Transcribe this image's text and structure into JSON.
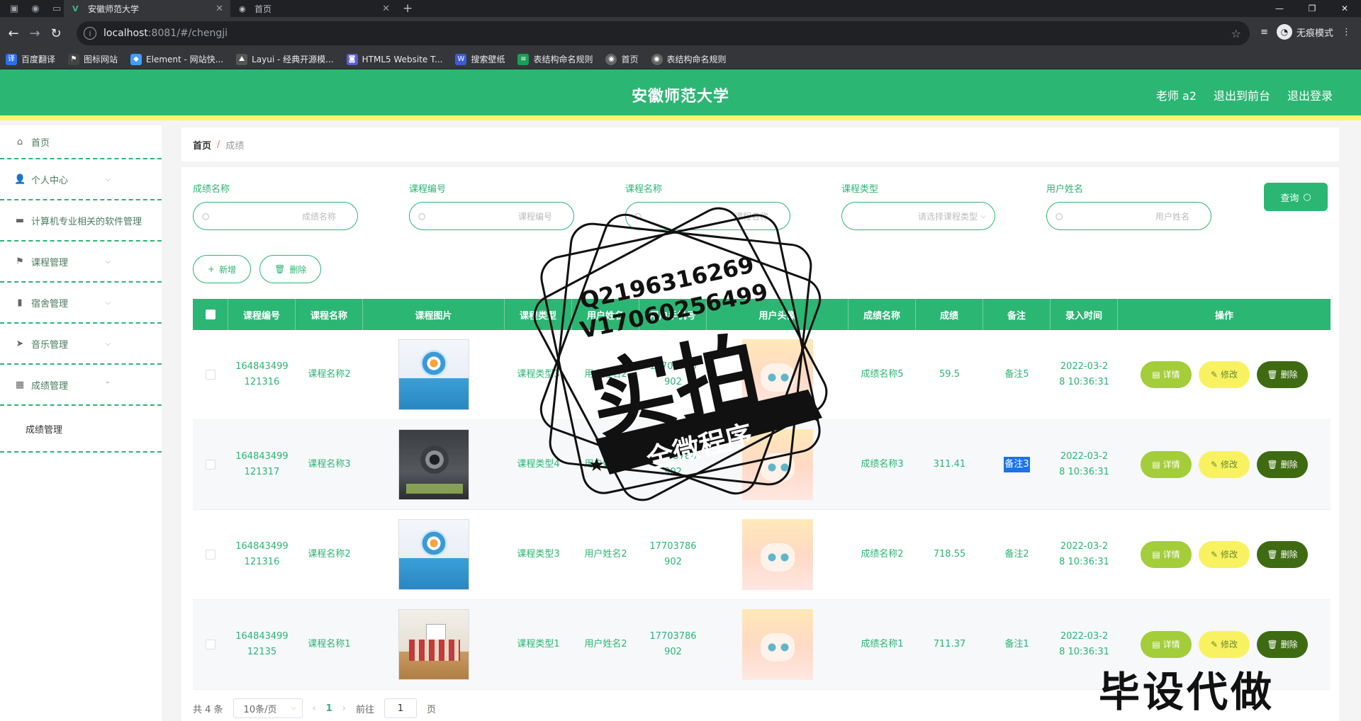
{
  "browser": {
    "tabs": [
      {
        "label": "安徽师范大学",
        "active": true
      },
      {
        "label": "首页",
        "active": false
      }
    ],
    "url_host": "localhost",
    "url_rest": ":8081/#/chengji",
    "profile_label": "无痕模式",
    "bookmarks": [
      "百度翻译",
      "图标网站",
      "Element - 网站快...",
      "Layui - 经典开源模...",
      "HTML5 Website T...",
      "搜索壁纸",
      "表结构命名规则",
      "首页",
      "表结构命名规则"
    ]
  },
  "header": {
    "title": "安徽师范大学",
    "nav": [
      "老师 a2",
      "退出到前台",
      "退出登录"
    ]
  },
  "sidebar": {
    "items": [
      {
        "label": "首页",
        "icon": "home-icon"
      },
      {
        "label": "个人中心",
        "icon": "user-icon"
      },
      {
        "label": "计算机专业相关的软件管理",
        "icon": "briefcase-icon"
      },
      {
        "label": "课程管理",
        "icon": "flag-icon"
      },
      {
        "label": "宿舍管理",
        "icon": "bar-chart-icon"
      },
      {
        "label": "音乐管理",
        "icon": "send-icon"
      },
      {
        "label": "成绩管理",
        "icon": "grid-icon"
      }
    ],
    "subitem": "成绩管理"
  },
  "breadcrumb": {
    "home": "首页",
    "sep": "/",
    "current": "成绩"
  },
  "filters": {
    "chengji_label": "成绩名称",
    "chengji_ph": "成绩名称",
    "kcbh_label": "课程编号",
    "kcbh_ph": "课程编号",
    "kcmc_label": "课程名称",
    "kcmc_ph": "课程名称",
    "kclx_label": "课程类型",
    "kclx_ph": "请选择课程类型",
    "yhxm_label": "用户姓名",
    "yhxm_ph": "用户姓名",
    "query_label": "查询"
  },
  "actions": {
    "add_label": "新增",
    "delete_label": "删除"
  },
  "table": {
    "columns": [
      "课程编号",
      "课程名称",
      "课程图片",
      "课程类型",
      "用户姓名",
      "用户手机号",
      "用户头像",
      "成绩名称",
      "成绩",
      "备注",
      "录入时间",
      "操作"
    ],
    "rows": [
      {
        "kcbh": "164843499\n121316",
        "kcmc": "课程名称2",
        "img": "book-a",
        "kclx": "课程类型3",
        "yhxm": "用户姓名2",
        "phone": "17703786\n902",
        "cjmc": "成绩名称5",
        "cj": "59.5",
        "bz": "备注5",
        "time": "2022-03-2\n8 10:36:31"
      },
      {
        "kcbh": "164843499\n121317",
        "kcmc": "课程名称3",
        "img": "book-b",
        "kclx": "课程类型4",
        "yhxm": "用户姓名2",
        "phone": "17703786\n902",
        "cjmc": "成绩名称3",
        "cj": "311.41",
        "bz": "备注3",
        "time": "2022-03-2\n8 10:36:31"
      },
      {
        "kcbh": "164843499\n121316",
        "kcmc": "课程名称2",
        "img": "book-a",
        "kclx": "课程类型3",
        "yhxm": "用户姓名2",
        "phone": "17703786\n902",
        "cjmc": "成绩名称2",
        "cj": "718.55",
        "bz": "备注2",
        "time": "2022-03-2\n8 10:36:31"
      },
      {
        "kcbh": "164843499\n12135",
        "kcmc": "课程名称1",
        "img": "book-c",
        "kclx": "课程类型1",
        "yhxm": "用户姓名2",
        "phone": "17703786\n902",
        "cjmc": "成绩名称1",
        "cj": "711.37",
        "bz": "备注1",
        "time": "2022-03-2\n8 10:36:31"
      }
    ],
    "op_detail": "详情",
    "op_edit": "修改",
    "op_delete": "删除"
  },
  "pager": {
    "total": "共 4 条",
    "size": "10条/页",
    "current": "1",
    "goto": "前往",
    "goto_value": "1",
    "page_suffix": "页"
  },
  "watermark": {
    "contact1": "Q2196316269",
    "contact2": "V17060256499",
    "big": "实拍",
    "banner": "全微程序",
    "bottom": "毕设代做"
  },
  "colors": {
    "brand": "#2bb673",
    "accent_bar": "#f6f56b",
    "detail_btn": "#a4cd3a",
    "edit_btn": "#f8f261",
    "delete_btn": "#3e6b12"
  }
}
